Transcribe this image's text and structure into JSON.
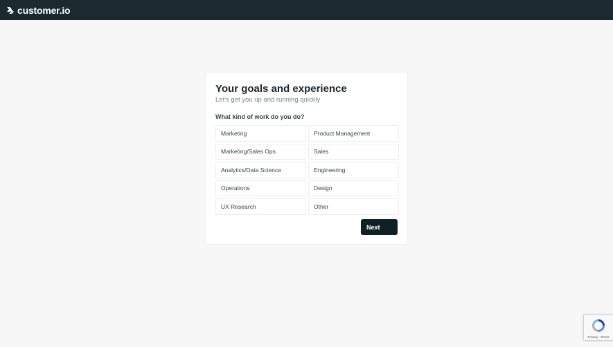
{
  "header": {
    "brand": "customer.io",
    "logo_icon": "customerio-logo-icon",
    "background": "#1b2a30"
  },
  "card": {
    "title": "Your goals and experience",
    "subtitle": "Let's get you up and running quickly",
    "question": "What kind of work do you do?",
    "options": [
      {
        "label": "Marketing"
      },
      {
        "label": "Product Management"
      },
      {
        "label": "Marketing/Sales Ops"
      },
      {
        "label": "Sales"
      },
      {
        "label": "Analytics/Data Science"
      },
      {
        "label": "Engineering"
      },
      {
        "label": "Operations"
      },
      {
        "label": "Design"
      },
      {
        "label": "UX Research"
      },
      {
        "label": "Other"
      }
    ],
    "next_label": "Next",
    "next_color": "#0f2027"
  },
  "recaptcha": {
    "icon": "recaptcha-icon",
    "privacy": "Privacy",
    "separator": " - ",
    "terms": "Terms"
  }
}
